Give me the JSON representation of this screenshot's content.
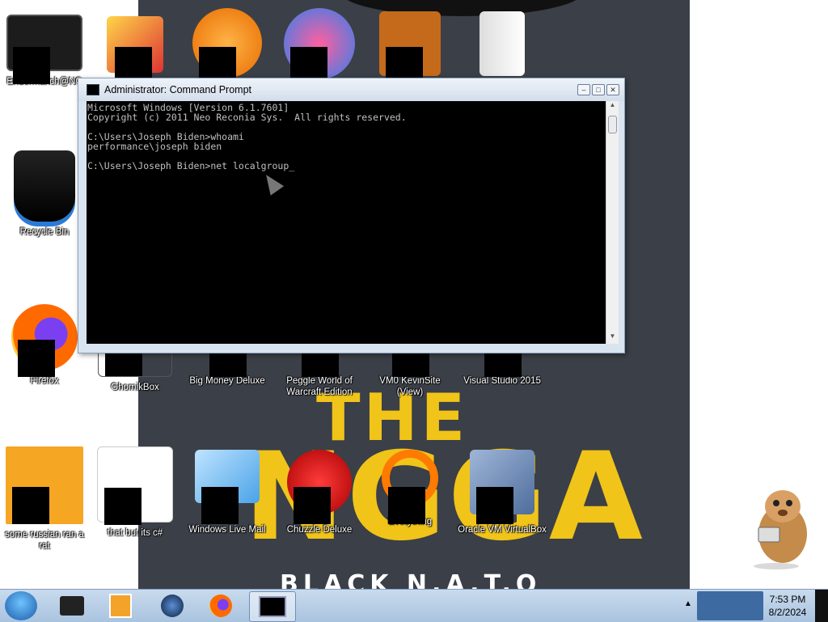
{
  "wallpaper": {
    "line1": "THE",
    "line2": "NGGA",
    "line3": "BLACK N.A.T.O"
  },
  "desktop_icons": [
    {
      "name": "Endermanch@NC",
      "icon": "notepad-icon"
    },
    {
      "name": "Recycle Bin",
      "icon": "recycle-bin-icon"
    },
    {
      "name": "Firefox",
      "icon": "firefox-icon"
    },
    {
      "name": "some russian ran a rat",
      "icon": "premiere-icon"
    },
    {
      "name": "GhomikBox",
      "icon": "app-icon"
    },
    {
      "name": "that but its c#",
      "icon": "stack-icon"
    },
    {
      "name": "Big Money Deluxe",
      "icon": "fish-icon"
    },
    {
      "name": "Windows Live Mail",
      "icon": "mail-icon"
    },
    {
      "name": "Peggle World of Warcraft Edition",
      "icon": "peggle-icon"
    },
    {
      "name": "Chuzzle Deluxe",
      "icon": "chuzzle-icon"
    },
    {
      "name": "VM0 KevinSite (View)",
      "icon": "vm-icon"
    },
    {
      "name": "Everything",
      "icon": "search-icon"
    },
    {
      "name": "Visual Studio 2015",
      "icon": "visual-studio-icon"
    },
    {
      "name": "Oracle VM VirtualBox",
      "icon": "virtualbox-icon"
    }
  ],
  "cmd": {
    "title": "Administrator: Command Prompt",
    "text": "Microsoft Windows [Version 6.1.7601]\nCopyright (c) 2011 Neo Reconia Sys.  All rights reserved.\n\nC:\\Users\\Joseph Biden>whoami\nperformance\\joseph biden\n\nC:\\Users\\Joseph Biden>net localgroup_"
  },
  "taskbar": {
    "items": [
      "start-button",
      "cmd-pinned",
      "media-player",
      "app-blue",
      "firefox",
      "command-prompt"
    ],
    "time": "7:53 PM",
    "date": "8/2/2024",
    "tray_arrow": "▲"
  },
  "colors": {
    "wallpaper": "#3b3f47",
    "accent": "#f0c419",
    "taskbar": "#b9d0e8"
  }
}
